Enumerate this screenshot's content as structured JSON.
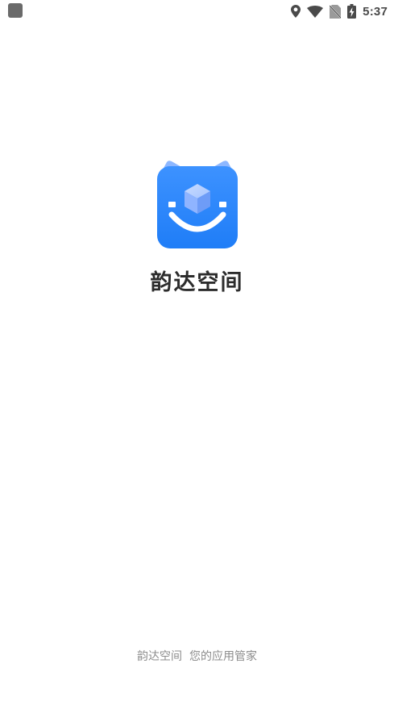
{
  "status_bar": {
    "time": "5:37",
    "icons": [
      "notification-icon",
      "location-icon",
      "wifi-icon",
      "no-sim-icon",
      "battery-charging-icon"
    ]
  },
  "splash": {
    "app_name": "韵达空间",
    "tagline": "韵达空间  您的应用管家",
    "logo_icon": "cube-smile-logo-icon"
  },
  "colors": {
    "logo_primary": "#2f87fb",
    "logo_light": "#8db7ff",
    "text_dark": "#2c2c2c",
    "text_gray": "#8c8c8c",
    "status_gray": "#4a4a4a"
  }
}
